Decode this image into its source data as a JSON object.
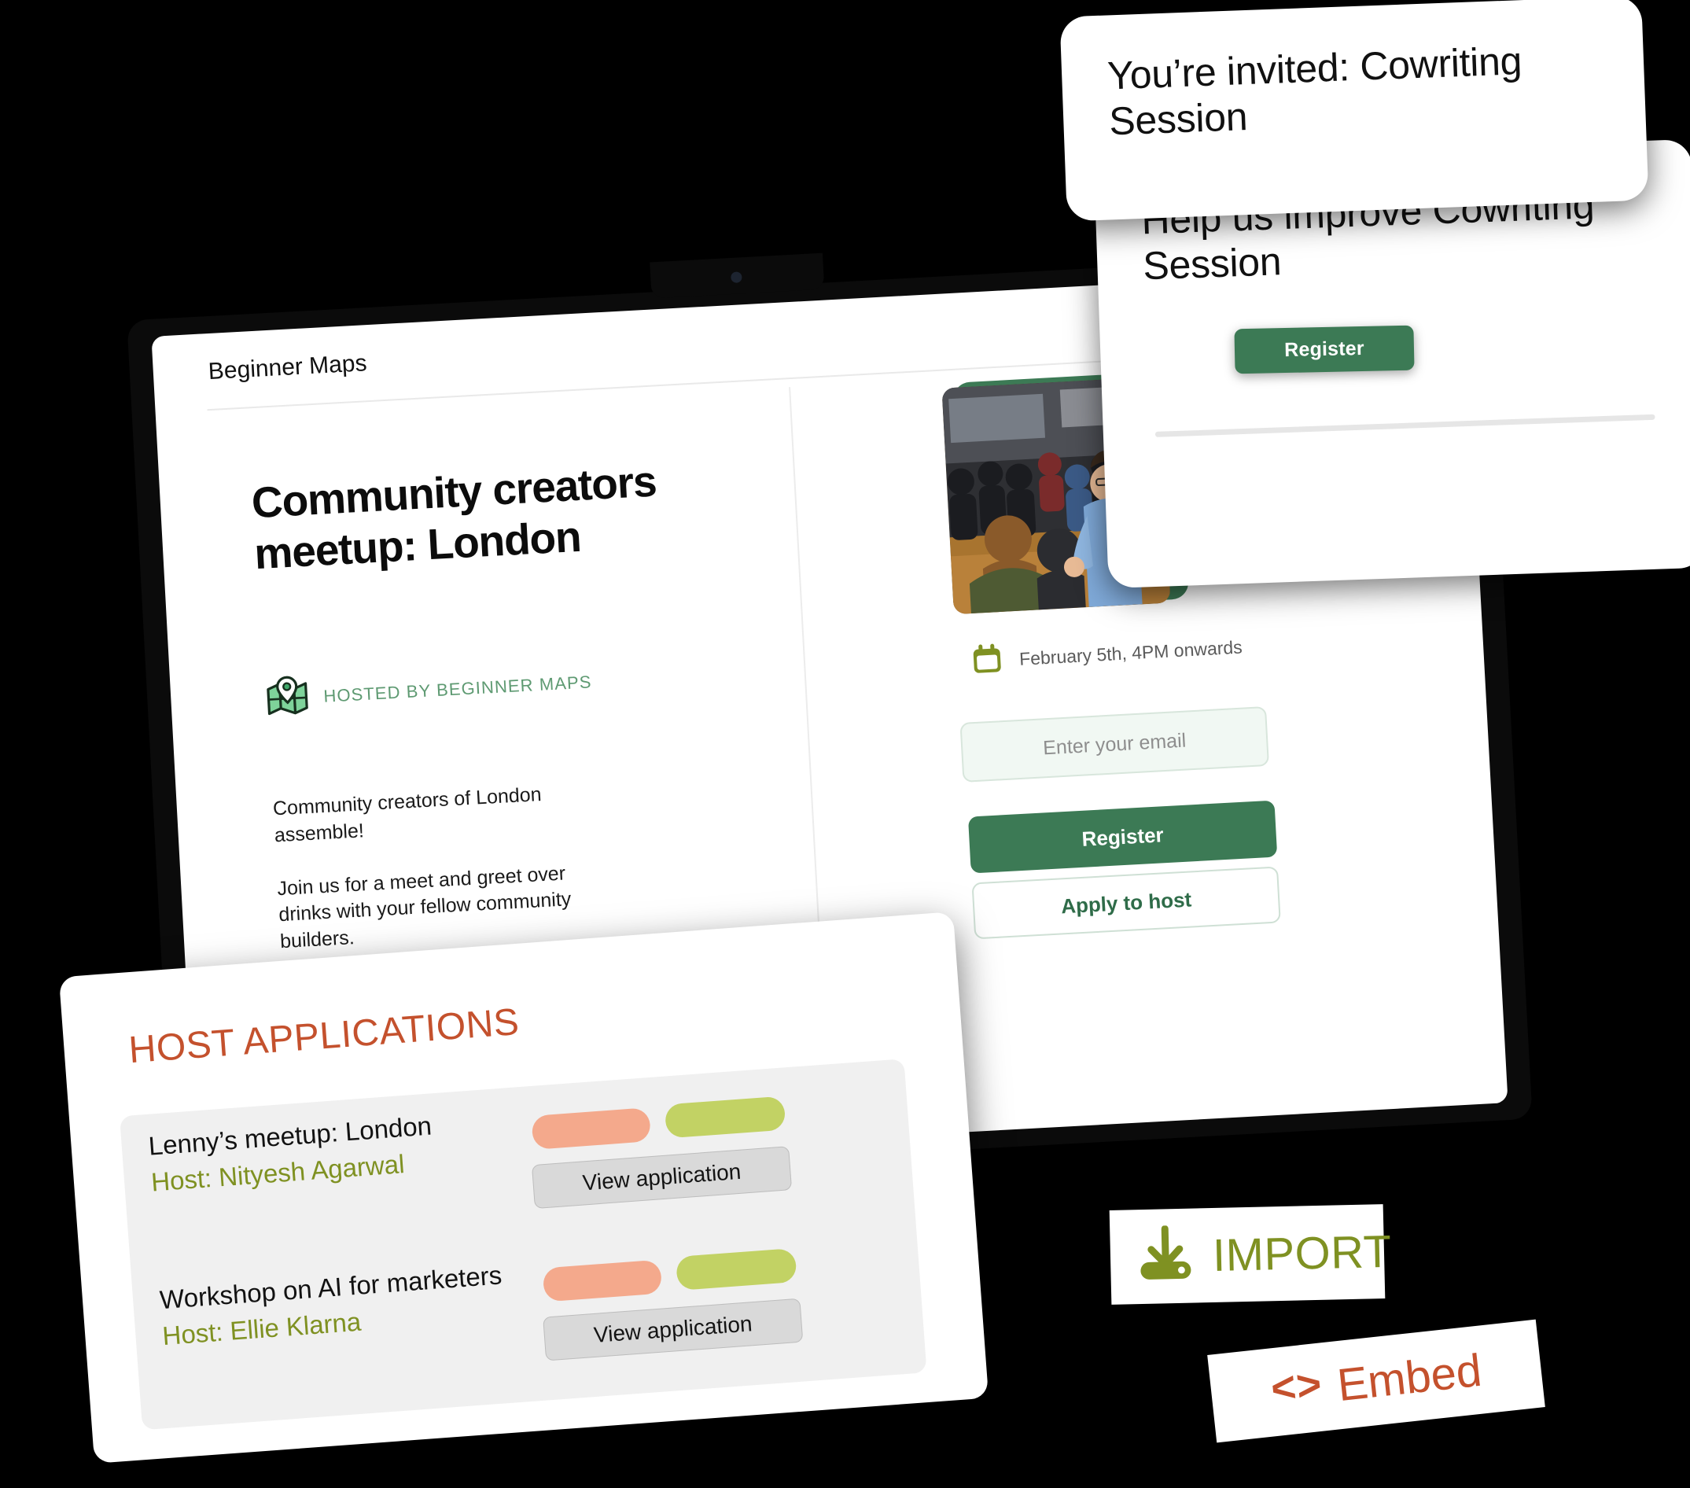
{
  "floating_cards": [
    {
      "id": "invite",
      "title": "You’re invited: Cowriting Session"
    },
    {
      "id": "improve",
      "title": "Help us improve Cowriting Session"
    }
  ],
  "floating_register_button": "Register",
  "laptop": {
    "brand": "Beginner Maps",
    "event": {
      "title": "Community creators meetup: London",
      "hosted_by": "HOSTED BY BEGINNER MAPS",
      "host_icon": "map-pin-icon",
      "description_paragraphs": [
        "Community creators of London assemble!",
        "Join us for a meet and greet over drinks with your fellow community builders."
      ],
      "date_icon": "calendar-icon",
      "date": "February 5th, 4PM onwards",
      "email_placeholder": "Enter your email",
      "email_value": "",
      "register_label": "Register",
      "apply_to_host_label": "Apply to host",
      "photo_alt": "speaker addressing a crowd at a meetup"
    }
  },
  "host_applications": {
    "title": "HOST APPLICATIONS",
    "view_application_label": "View application",
    "rows": [
      {
        "event": "Lenny’s meetup: London",
        "host": "Host: Nityesh Agarwal"
      },
      {
        "event": "Workshop on AI for marketers",
        "host": "Host: Ellie Klarna"
      }
    ]
  },
  "chips": {
    "import_label": "IMPORT",
    "import_icon": "download-icon",
    "embed_label": "Embed",
    "embed_glyph": "<>"
  },
  "colors": {
    "brand_green": "#3c7a55",
    "olive": "#7f9122",
    "terracotta": "#c4512d",
    "pill_red": "#f4a98c",
    "pill_green": "#c2d264",
    "background": "#000000"
  }
}
